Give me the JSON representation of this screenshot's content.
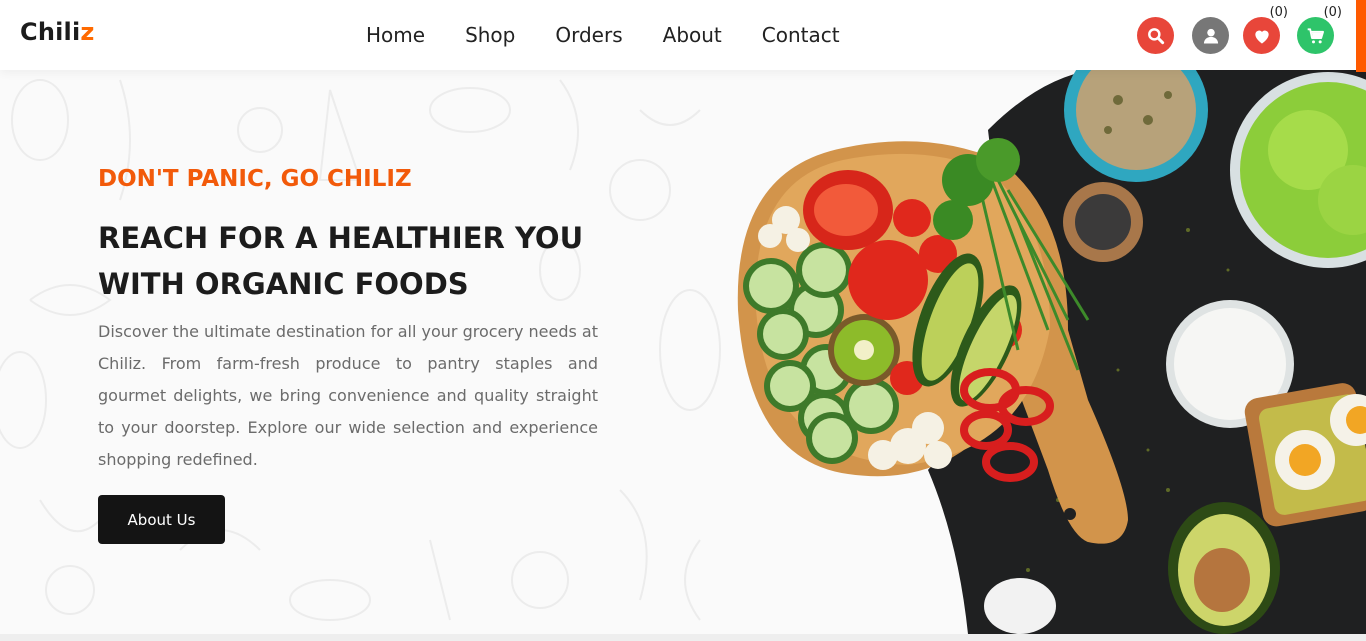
{
  "brand": {
    "name_main": "Chili",
    "name_accent": "z"
  },
  "nav": {
    "items": [
      "Home",
      "Shop",
      "Orders",
      "About",
      "Contact"
    ]
  },
  "header_icons": {
    "search": {
      "icon": "search-icon",
      "color": "#e8463a"
    },
    "account": {
      "icon": "user-icon",
      "color": "#777777"
    },
    "wishlist": {
      "icon": "heart-icon",
      "color": "#e8463a",
      "count": "(0)"
    },
    "cart": {
      "icon": "cart-icon",
      "color": "#2ec46a",
      "count": "(0)"
    }
  },
  "hero": {
    "tagline": "DON'T PANIC, GO CHILIZ",
    "headline_line1": "REACH FOR A HEALTHIER YOU",
    "headline_line2": "WITH ORGANIC FOODS",
    "description": "Discover the ultimate destination for all your grocery needs at Chiliz. From farm-fresh produce to pantry staples and gourmet delights, we bring convenience and quality straight to your doorstep. Explore our wide selection and experience shopping redefined.",
    "cta_label": "About Us"
  },
  "colors": {
    "accent": "#f25a0a",
    "dark": "#141414"
  }
}
